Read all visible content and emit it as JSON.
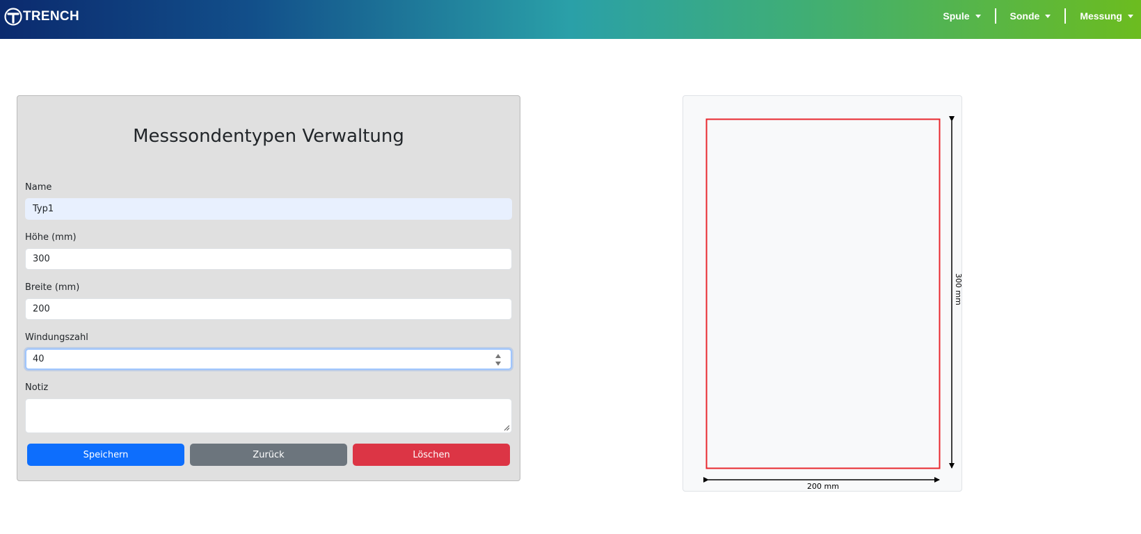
{
  "brand": {
    "name": "TRENCH",
    "logo_icon": "trench-logo-icon"
  },
  "nav": {
    "items": [
      {
        "label": "Spule",
        "icon": "caret-down-icon"
      },
      {
        "label": "Sonde",
        "icon": "caret-down-icon"
      },
      {
        "label": "Messung",
        "icon": "caret-down-icon"
      }
    ]
  },
  "form": {
    "title": "Messsondentypen Verwaltung",
    "name": {
      "label": "Name",
      "value": "Typ1"
    },
    "hoehe": {
      "label": "Höhe (mm)",
      "value": "300"
    },
    "breite": {
      "label": "Breite (mm)",
      "value": "200"
    },
    "windungszahl": {
      "label": "Windungszahl",
      "value": "40"
    },
    "notiz": {
      "label": "Notiz",
      "value": ""
    },
    "buttons": {
      "save": {
        "label": "Speichern",
        "color": "#0d6efd"
      },
      "back": {
        "label": "Zurück",
        "color": "#6c757d"
      },
      "delete": {
        "label": "Löschen",
        "color": "#dc3545"
      }
    }
  },
  "preview": {
    "height_label": "300 mm",
    "width_label": "200 mm",
    "probe_height_mm": 300,
    "probe_width_mm": 200,
    "outline_color": "#e8282d"
  }
}
